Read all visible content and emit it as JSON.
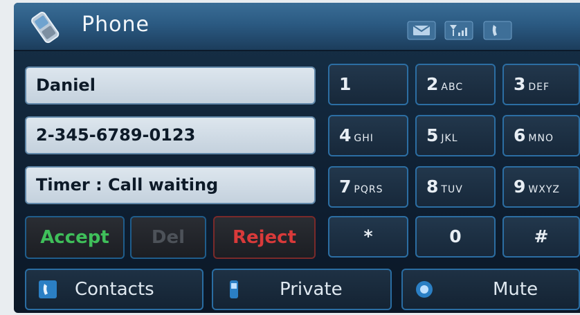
{
  "header": {
    "title": "Phone"
  },
  "fields": {
    "caller_name": "Daniel",
    "number": "2-345-6789-0123",
    "status": "Timer : Call waiting"
  },
  "keypad": [
    {
      "digit": "1",
      "letters": ""
    },
    {
      "digit": "2",
      "letters": "ABC"
    },
    {
      "digit": "3",
      "letters": "DEF"
    },
    {
      "digit": "4",
      "letters": "GHI"
    },
    {
      "digit": "5",
      "letters": "JKL"
    },
    {
      "digit": "6",
      "letters": "MNO"
    },
    {
      "digit": "7",
      "letters": "PQRS"
    },
    {
      "digit": "8",
      "letters": "TUV"
    },
    {
      "digit": "9",
      "letters": "WXYZ"
    },
    {
      "digit": "*",
      "letters": ""
    },
    {
      "digit": "0",
      "letters": ""
    },
    {
      "digit": "#",
      "letters": ""
    }
  ],
  "controls": {
    "accept": "Accept",
    "del": "Del",
    "reject": "Reject"
  },
  "bottom": {
    "contacts": "Contacts",
    "private": "Private",
    "mute": "Mute"
  },
  "colors": {
    "accept": "#3fbf5a",
    "reject": "#d93a3a",
    "disabled": "#4d5259",
    "accent": "#2c6ea3"
  },
  "icons": {
    "app": "phone-handset-icon",
    "status": [
      "message-icon",
      "signal-strength-icon",
      "call-icon"
    ]
  }
}
